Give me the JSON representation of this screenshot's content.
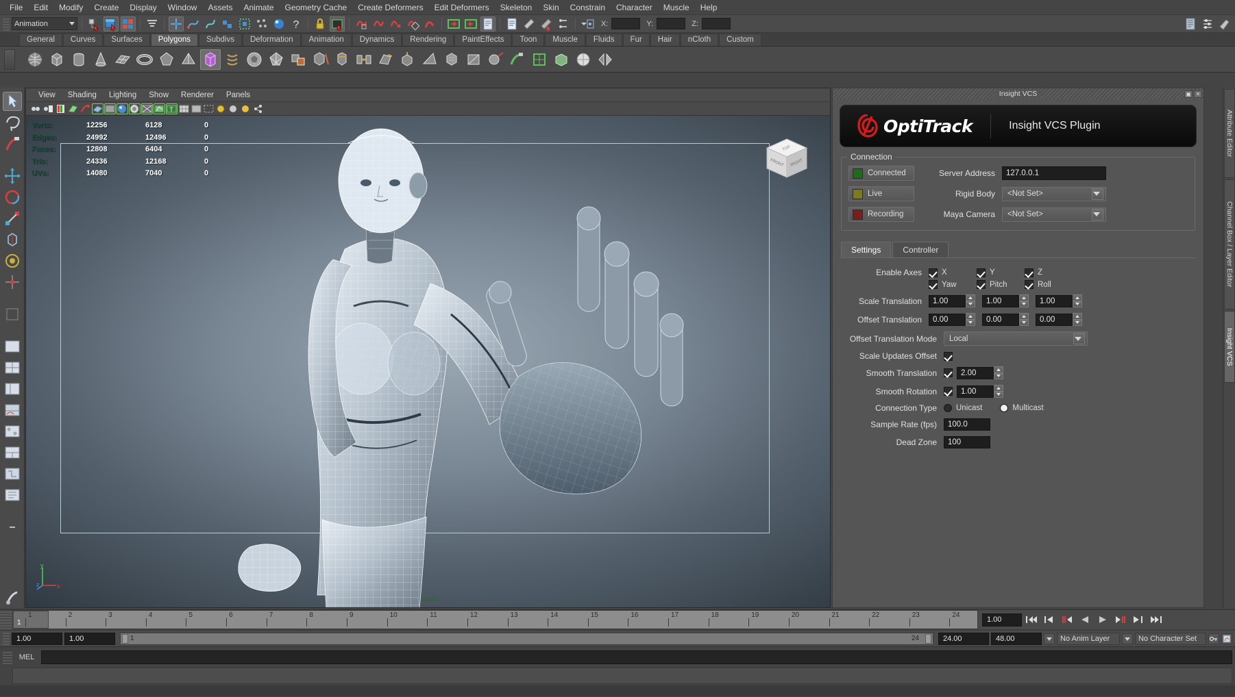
{
  "menubar": {
    "items": [
      "File",
      "Edit",
      "Modify",
      "Create",
      "Display",
      "Window",
      "Assets",
      "Animate",
      "Geometry Cache",
      "Create Deformers",
      "Edit Deformers",
      "Skeleton",
      "Skin",
      "Constrain",
      "Character",
      "Muscle",
      "Help"
    ]
  },
  "statusline": {
    "mode": "Animation",
    "axis_x_label": "X:",
    "axis_y_label": "Y:",
    "axis_z_label": "Z:",
    "axis_x_value": "",
    "axis_y_value": "",
    "axis_z_value": ""
  },
  "shelf": {
    "tabs": [
      "General",
      "Curves",
      "Surfaces",
      "Polygons",
      "Subdivs",
      "Deformation",
      "Animation",
      "Dynamics",
      "Rendering",
      "PaintEffects",
      "Toon",
      "Muscle",
      "Fluids",
      "Fur",
      "Hair",
      "nCloth",
      "Custom"
    ],
    "active_tab": "Polygons"
  },
  "viewport": {
    "menu": [
      "View",
      "Shading",
      "Lighting",
      "Show",
      "Renderer",
      "Panels"
    ],
    "camera_label": "persp",
    "hud": {
      "rows": [
        {
          "label": "Verts:",
          "total": "12256",
          "selected": "6128",
          "other": "0"
        },
        {
          "label": "Edges:",
          "total": "24992",
          "selected": "12496",
          "other": "0"
        },
        {
          "label": "Faces:",
          "total": "12808",
          "selected": "6404",
          "other": "0"
        },
        {
          "label": "Tris:",
          "total": "24336",
          "selected": "12168",
          "other": "0"
        },
        {
          "label": "UVs:",
          "total": "14080",
          "selected": "7040",
          "other": "0"
        }
      ]
    },
    "viewcube": {
      "top": "TOP",
      "front": "FRONT",
      "right": "RIGHT"
    },
    "axis_gizmo": {
      "x": "x",
      "y": "y",
      "z": "z"
    }
  },
  "dock": {
    "title": "Insight VCS",
    "banner": {
      "brand": "OptiTrack",
      "plugin_title": "Insight VCS Plugin"
    },
    "connection": {
      "group_label": "Connection",
      "status": [
        {
          "label": "Connected",
          "color": "#1d6b1d"
        },
        {
          "label": "Live",
          "color": "#7e7a1c"
        },
        {
          "label": "Recording",
          "color": "#7e1c1c"
        }
      ],
      "server_address_label": "Server Address",
      "server_address_value": "127.0.0.1",
      "rigid_body_label": "Rigid Body",
      "rigid_body_value": "<Not Set>",
      "maya_camera_label": "Maya Camera",
      "maya_camera_value": "<Not Set>"
    },
    "tabs": [
      {
        "label": "Settings",
        "active": true
      },
      {
        "label": "Controller",
        "active": false
      }
    ],
    "settings": {
      "enable_axes_label": "Enable Axes",
      "axes": [
        {
          "label": "X",
          "checked": true
        },
        {
          "label": "Y",
          "checked": true
        },
        {
          "label": "Z",
          "checked": true
        },
        {
          "label": "Yaw",
          "checked": true
        },
        {
          "label": "Pitch",
          "checked": true
        },
        {
          "label": "Roll",
          "checked": true
        }
      ],
      "scale_translation_label": "Scale Translation",
      "scale_translation_values": [
        "1.00",
        "1.00",
        "1.00"
      ],
      "offset_translation_label": "Offset Translation",
      "offset_translation_values": [
        "0.00",
        "0.00",
        "0.00"
      ],
      "offset_translation_mode_label": "Offset Translation Mode",
      "offset_translation_mode_value": "Local",
      "scale_updates_offset_label": "Scale Updates Offset",
      "scale_updates_offset_checked": true,
      "smooth_translation_label": "Smooth Translation",
      "smooth_translation_checked": true,
      "smooth_translation_value": "2.00",
      "smooth_rotation_label": "Smooth Rotation",
      "smooth_rotation_checked": true,
      "smooth_rotation_value": "1.00",
      "connection_type_label": "Connection Type",
      "connection_type_options": [
        {
          "label": "Unicast",
          "selected": false
        },
        {
          "label": "Multicast",
          "selected": true
        }
      ],
      "sample_rate_label": "Sample Rate (fps)",
      "sample_rate_value": "100.0",
      "dead_zone_label": "Dead Zone",
      "dead_zone_value": "100"
    }
  },
  "vertical_tabs": [
    {
      "label": "Attribute Editor",
      "active": false
    },
    {
      "label": "Channel Box / Layer Editor",
      "active": false
    },
    {
      "label": "Insight VCS",
      "active": true
    }
  ],
  "timeline": {
    "frames": [
      "1",
      "2",
      "3",
      "4",
      "5",
      "6",
      "7",
      "8",
      "9",
      "10",
      "11",
      "12",
      "13",
      "14",
      "15",
      "16",
      "17",
      "18",
      "19",
      "20",
      "21",
      "22",
      "23",
      "24"
    ],
    "current_frame": "1",
    "playback_speed": "1.00",
    "transport": [
      "go-to-start",
      "step-back-key",
      "step-back-frame",
      "play-backwards",
      "play-forwards",
      "step-forward-frame",
      "step-forward-key",
      "go-to-end"
    ]
  },
  "rangebar": {
    "start_field": "1.00",
    "end_field": "1.00",
    "range_start": "1",
    "range_end": "24",
    "anim_end": "24.00",
    "playback_end": "48.00",
    "anim_layer": "No Anim Layer",
    "character_set": "No Character Set"
  },
  "command_line": {
    "language_label": "MEL",
    "input_value": "",
    "output_value": ""
  }
}
